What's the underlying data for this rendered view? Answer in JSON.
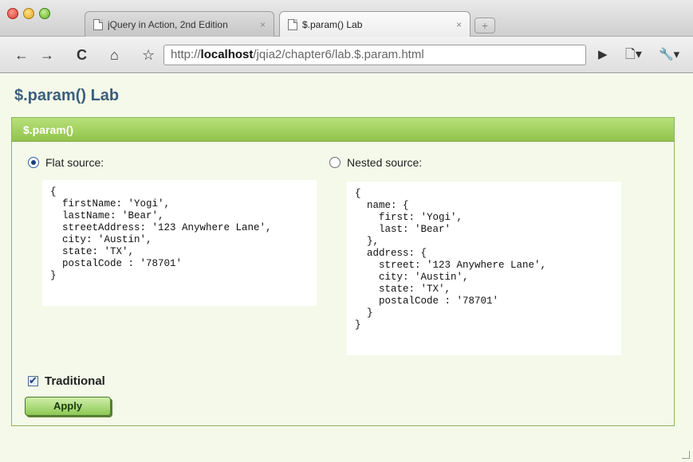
{
  "tabs": [
    {
      "title": "jQuery in Action, 2nd Edition",
      "close": "×"
    },
    {
      "title": "$.param() Lab",
      "close": "×"
    }
  ],
  "newtab_symbol": "+",
  "toolbar": {
    "back": "←",
    "forward": "→",
    "reload": "C",
    "home": "⌂",
    "bookmark": "☆",
    "url_prefix": "http://",
    "url_host": "localhost",
    "url_path": "/jqia2/chapter6/lab.$.param.html",
    "go": "▶",
    "page_menu": "🗋▾",
    "wrench": "🔧▾"
  },
  "page": {
    "title": "$.param() Lab",
    "module_title": "$.param()",
    "flat_label": "Flat source:",
    "nested_label": "Nested source:",
    "flat_selected": true,
    "flat_code": "{\n  firstName: 'Yogi',\n  lastName: 'Bear',\n  streetAddress: '123 Anywhere Lane',\n  city: 'Austin',\n  state: 'TX',\n  postalCode : '78701'\n}",
    "nested_code": "{\n  name: {\n    first: 'Yogi',\n    last: 'Bear'\n  },\n  address: {\n    street: '123 Anywhere Lane',\n    city: 'Austin',\n    state: 'TX',\n    postalCode : '78701'\n  }\n}",
    "traditional_label": "Traditional",
    "traditional_checked": true,
    "apply_label": "Apply"
  }
}
